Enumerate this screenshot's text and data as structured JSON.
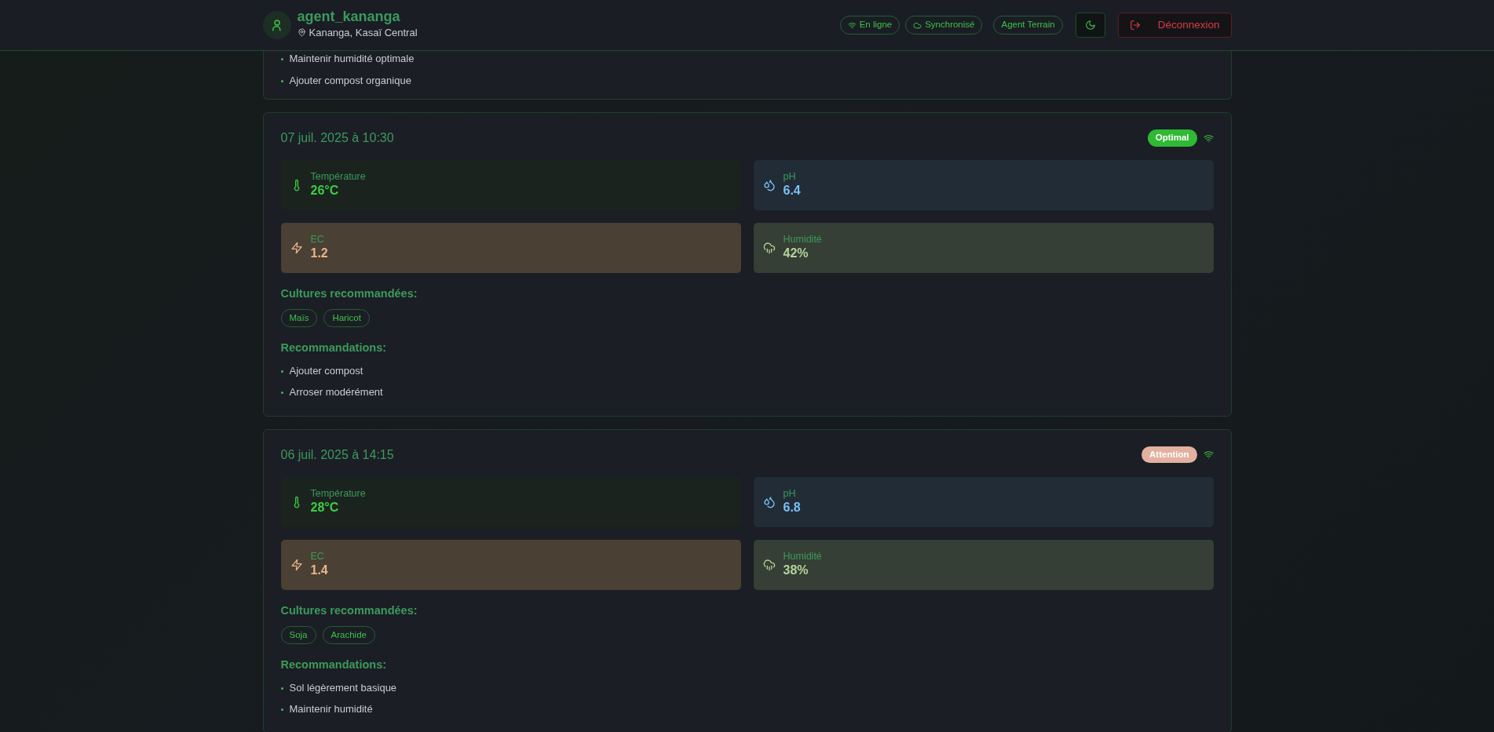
{
  "header": {
    "username": "agent_kananga",
    "location": "Kananga, Kasaï Central",
    "badges": [
      {
        "kind": "online",
        "label": "En ligne"
      },
      {
        "kind": "sync",
        "label": "Synchronisé"
      },
      {
        "kind": "role",
        "label": "Agent Terrain"
      }
    ],
    "logout": "Déconnexion"
  },
  "previous_card": {
    "recommendations": [
      "Maintenir humidité optimale",
      "Ajouter compost organique"
    ]
  },
  "readings": [
    {
      "date": "07 juil. 2025 à 10:30",
      "status": {
        "kind": "optimal",
        "label": "Optimal"
      },
      "metrics": [
        {
          "kind": "temperature",
          "label": "Température",
          "value": "26°C"
        },
        {
          "kind": "ph",
          "label": "pH",
          "value": "6.4"
        },
        {
          "kind": "ec",
          "label": "EC",
          "value": "1.2"
        },
        {
          "kind": "humidity",
          "label": "Humidité",
          "value": "42%"
        }
      ],
      "crops_title": "Cultures recommandées:",
      "crops": [
        "Maïs",
        "Haricot"
      ],
      "recs_title": "Recommandations:",
      "recommendations": [
        "Ajouter compost",
        "Arroser modérément"
      ]
    },
    {
      "date": "06 juil. 2025 à 14:15",
      "status": {
        "kind": "attention",
        "label": "Attention"
      },
      "metrics": [
        {
          "kind": "temperature",
          "label": "Température",
          "value": "28°C"
        },
        {
          "kind": "ph",
          "label": "pH",
          "value": "6.8"
        },
        {
          "kind": "ec",
          "label": "EC",
          "value": "1.4"
        },
        {
          "kind": "humidity",
          "label": "Humidité",
          "value": "38%"
        }
      ],
      "crops_title": "Cultures recommandées:",
      "crops": [
        "Soja",
        "Arachide"
      ],
      "recs_title": "Recommandations:",
      "recommendations": [
        "Sol légèrement basique",
        "Maintenir humidité"
      ]
    }
  ]
}
